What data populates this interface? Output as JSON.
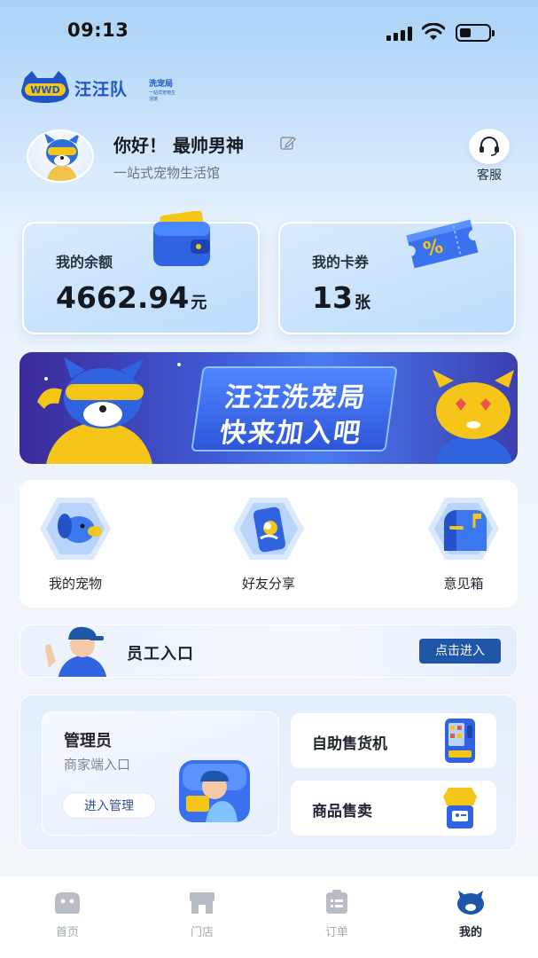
{
  "status_bar": {
    "time": "09:13"
  },
  "logo": {
    "brand": "汪汪队",
    "sub": "洗宠局",
    "badge": "WWD",
    "tagline": "一站式宠物生活馆"
  },
  "profile": {
    "greeting": "你好！ 最帅男神",
    "tagline": "一站式宠物生活馆",
    "service_label": "客服"
  },
  "cards": {
    "balance": {
      "title": "我的余额",
      "amount": "4662.94",
      "unit": "元"
    },
    "coupon": {
      "title": "我的卡券",
      "amount": "13",
      "unit": "张",
      "icon_text": "%"
    }
  },
  "banner": {
    "line1": "汪汪洗宠局",
    "line2": "快来加入吧"
  },
  "quick_actions": [
    {
      "label": "我的宠物",
      "icon": "dog-icon"
    },
    {
      "label": "好友分享",
      "icon": "share-phone-icon"
    },
    {
      "label": "意见箱",
      "icon": "mailbox-icon"
    }
  ],
  "staff": {
    "title": "员工入口",
    "button": "点击进入"
  },
  "admin": {
    "title": "管理员",
    "sub": "商家端入口",
    "button": "进入管理",
    "vending": "自助售货机",
    "goods": "商品售卖"
  },
  "tabbar": [
    {
      "label": "首页",
      "icon": "home-icon",
      "active": false
    },
    {
      "label": "门店",
      "icon": "store-icon",
      "active": false
    },
    {
      "label": "订单",
      "icon": "order-icon",
      "active": false
    },
    {
      "label": "我的",
      "icon": "mine-icon",
      "active": true
    }
  ],
  "colors": {
    "accent": "#1f56a8",
    "brand": "#1f54c6",
    "active_tab": "#1f2430",
    "inactive_tab": "#a2a8b2"
  }
}
